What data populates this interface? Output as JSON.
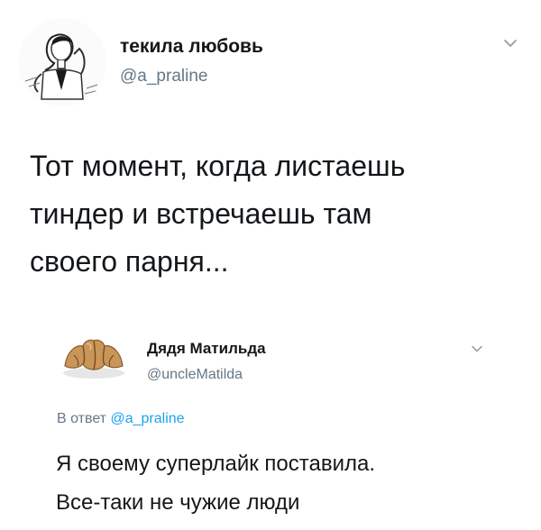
{
  "tweet": {
    "display_name": "текила любовь",
    "handle": "@a_praline",
    "text_lines": [
      "Тот момент, когда листаешь",
      "тиндер и встречаешь там",
      "своего парня..."
    ],
    "avatar_icon": "woman-portrait-sketch-avatar",
    "menu_icon": "chevron-down-icon"
  },
  "reply": {
    "display_name": "Дядя Матильда",
    "handle": "@uncleMatilda",
    "in_reply_prefix": "В ответ",
    "in_reply_mention": "@a_praline",
    "text_lines": [
      "Я своему суперлайк поставила.",
      "Все-таки не чужие люди"
    ],
    "avatar_icon": "croissant-avatar",
    "menu_icon": "chevron-down-icon"
  },
  "colors": {
    "text": "#14171a",
    "secondary": "#657786",
    "mention": "#1da1f2",
    "chevron": "#8899a6"
  }
}
